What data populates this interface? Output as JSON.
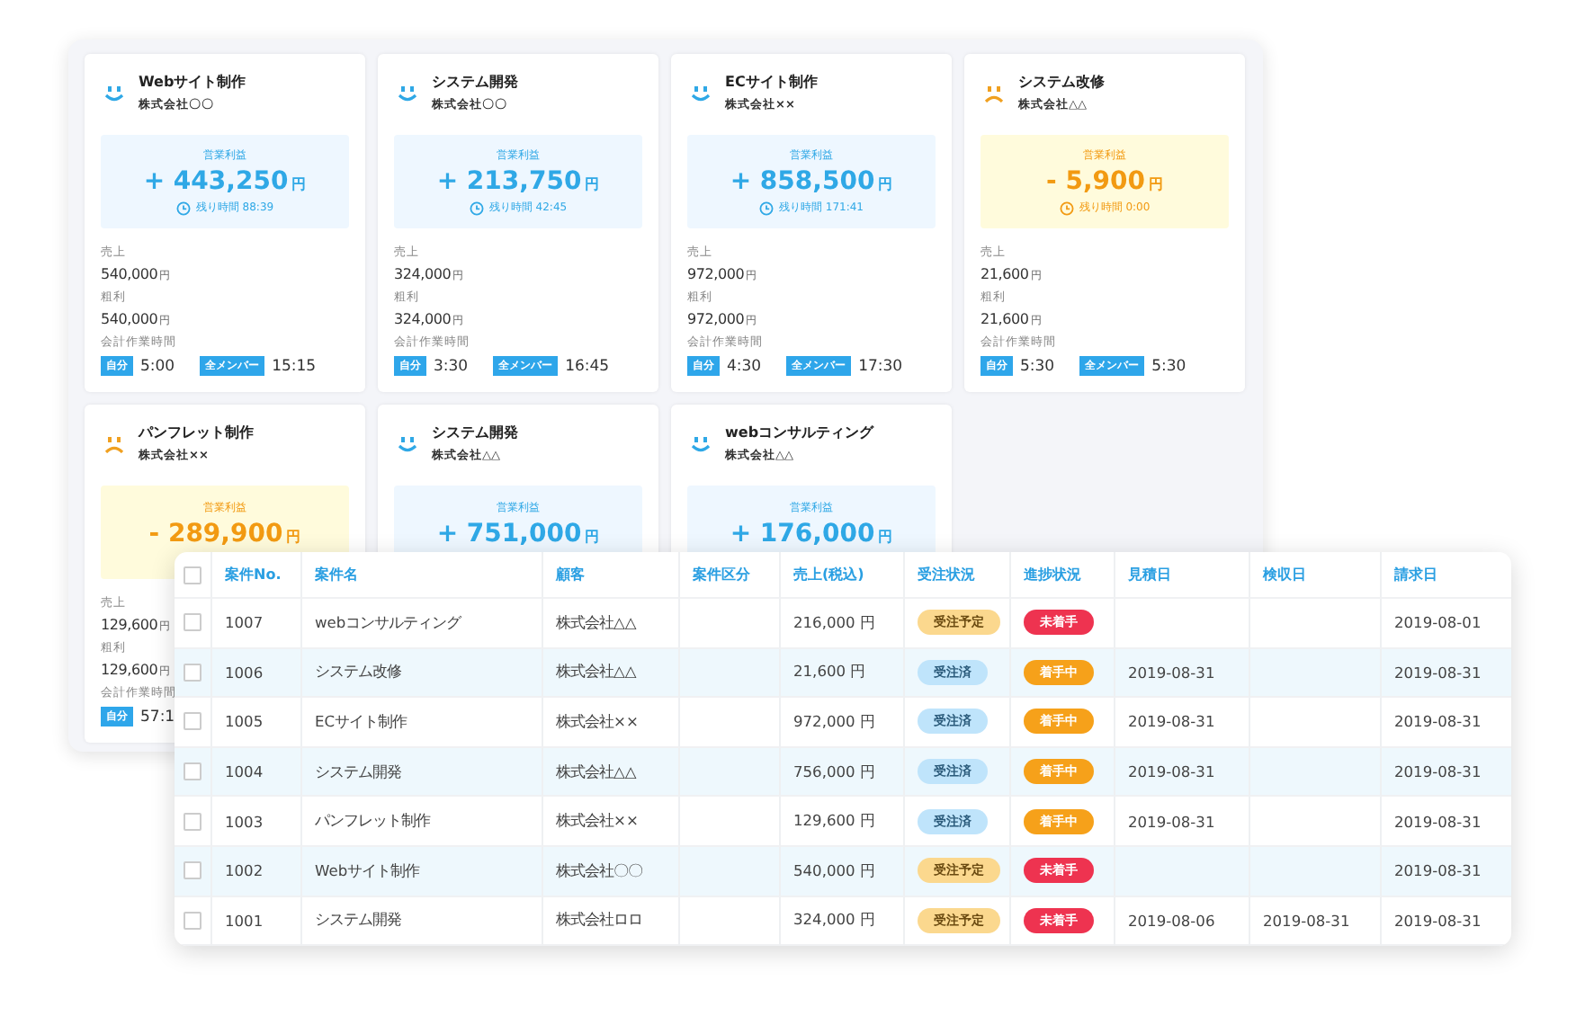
{
  "cards": [
    {
      "kind": "profit",
      "title": "Webサイト制作",
      "client": "株式会社〇〇",
      "profit_label": "営業利益",
      "amount": "+ 443,250",
      "amount_unit": "円",
      "remaining": "残り時間 88:39",
      "sales_label": "売上",
      "sales": "540,000",
      "sales_unit": "円",
      "gross_label": "粗利",
      "gross": "540,000",
      "gross_unit": "円",
      "hours_label": "会計作業時間",
      "hours": [
        {
          "label": "自分",
          "time": "5:00"
        },
        {
          "label": "全メンバー",
          "time": "15:15"
        }
      ]
    },
    {
      "kind": "profit",
      "title": "システム開発",
      "client": "株式会社〇〇",
      "profit_label": "営業利益",
      "amount": "+ 213,750",
      "amount_unit": "円",
      "remaining": "残り時間 42:45",
      "sales_label": "売上",
      "sales": "324,000",
      "sales_unit": "円",
      "gross_label": "粗利",
      "gross": "324,000",
      "gross_unit": "円",
      "hours_label": "会計作業時間",
      "hours": [
        {
          "label": "自分",
          "time": "3:30"
        },
        {
          "label": "全メンバー",
          "time": "16:45"
        }
      ]
    },
    {
      "kind": "profit",
      "title": "ECサイト制作",
      "client": "株式会社××",
      "profit_label": "営業利益",
      "amount": "+ 858,500",
      "amount_unit": "円",
      "remaining": "残り時間 171:41",
      "sales_label": "売上",
      "sales": "972,000",
      "sales_unit": "円",
      "gross_label": "粗利",
      "gross": "972,000",
      "gross_unit": "円",
      "hours_label": "会計作業時間",
      "hours": [
        {
          "label": "自分",
          "time": "4:30"
        },
        {
          "label": "全メンバー",
          "time": "17:30"
        }
      ]
    },
    {
      "kind": "loss",
      "title": "システム改修",
      "client": "株式会社△△",
      "profit_label": "営業利益",
      "amount": "- 5,900",
      "amount_unit": "円",
      "remaining": "残り時間 0:00",
      "sales_label": "売上",
      "sales": "21,600",
      "sales_unit": "円",
      "gross_label": "粗利",
      "gross": "21,600",
      "gross_unit": "円",
      "hours_label": "会計作業時間",
      "hours": [
        {
          "label": "自分",
          "time": "5:30"
        },
        {
          "label": "全メンバー",
          "time": "5:30"
        }
      ]
    },
    {
      "kind": "loss",
      "title": "パンフレット制作",
      "client": "株式会社××",
      "profit_label": "営業利益",
      "amount": "- 289,900",
      "amount_unit": "円",
      "sales_label": "売上",
      "sales": "129,600",
      "sales_unit": "円",
      "gross_label": "粗利",
      "gross": "129,600",
      "gross_unit": "円",
      "hours_label": "会計作業時間",
      "hours": [
        {
          "label": "自分",
          "time": "57:1"
        }
      ]
    },
    {
      "kind": "profit",
      "title": "システム開発",
      "client": "株式会社△△",
      "profit_label": "営業利益",
      "amount": "+ 751,000",
      "amount_unit": "円"
    },
    {
      "kind": "profit",
      "title": "webコンサルティング",
      "client": "株式会社△△",
      "profit_label": "営業利益",
      "amount": "+ 176,000",
      "amount_unit": "円"
    }
  ],
  "table": {
    "header_checked": false,
    "columns": [
      "案件No.",
      "案件名",
      "顧客",
      "案件区分",
      "売上(税込)",
      "受注状況",
      "進捗状況",
      "見積日",
      "検収日",
      "請求日"
    ],
    "rows": [
      {
        "checked": false,
        "no": "1007",
        "name": "webコンサルティング",
        "client": "株式会社△△",
        "sales": "216,000 円",
        "order": {
          "kind": "planned",
          "label": "受注予定"
        },
        "progress": {
          "kind": "not_started",
          "label": "未着手"
        },
        "invoice_date": "2019-08-01"
      },
      {
        "checked": false,
        "no": "1006",
        "name": "システム改修",
        "client": "株式会社△△",
        "sales": "21,600 円",
        "order": {
          "kind": "received",
          "label": "受注済"
        },
        "progress": {
          "kind": "in_progress",
          "label": "着手中"
        },
        "estimate_date": "2019-08-31",
        "invoice_date": "2019-08-31"
      },
      {
        "checked": false,
        "no": "1005",
        "name": "ECサイト制作",
        "client": "株式会社××",
        "sales": "972,000 円",
        "order": {
          "kind": "received",
          "label": "受注済"
        },
        "progress": {
          "kind": "in_progress",
          "label": "着手中"
        },
        "estimate_date": "2019-08-31",
        "invoice_date": "2019-08-31"
      },
      {
        "checked": false,
        "no": "1004",
        "name": "システム開発",
        "client": "株式会社△△",
        "sales": "756,000 円",
        "order": {
          "kind": "received",
          "label": "受注済"
        },
        "progress": {
          "kind": "in_progress",
          "label": "着手中"
        },
        "estimate_date": "2019-08-31",
        "invoice_date": "2019-08-31"
      },
      {
        "checked": false,
        "no": "1003",
        "name": "パンフレット制作",
        "client": "株式会社××",
        "sales": "129,600 円",
        "order": {
          "kind": "received",
          "label": "受注済"
        },
        "progress": {
          "kind": "in_progress",
          "label": "着手中"
        },
        "estimate_date": "2019-08-31",
        "invoice_date": "2019-08-31"
      },
      {
        "checked": false,
        "no": "1002",
        "name": "Webサイト制作",
        "client": "株式会社〇〇",
        "sales": "540,000 円",
        "order": {
          "kind": "planned",
          "label": "受注予定"
        },
        "progress": {
          "kind": "not_started",
          "label": "未着手"
        },
        "invoice_date": "2019-08-31"
      },
      {
        "checked": false,
        "no": "1001",
        "name": "システム開発",
        "client": "株式会社ロロ",
        "sales": "324,000 円",
        "order": {
          "kind": "planned",
          "label": "受注予定"
        },
        "progress": {
          "kind": "not_started",
          "label": "未着手"
        },
        "estimate_date": "2019-08-06",
        "acceptance_date": "2019-08-31",
        "invoice_date": "2019-08-31"
      }
    ]
  }
}
